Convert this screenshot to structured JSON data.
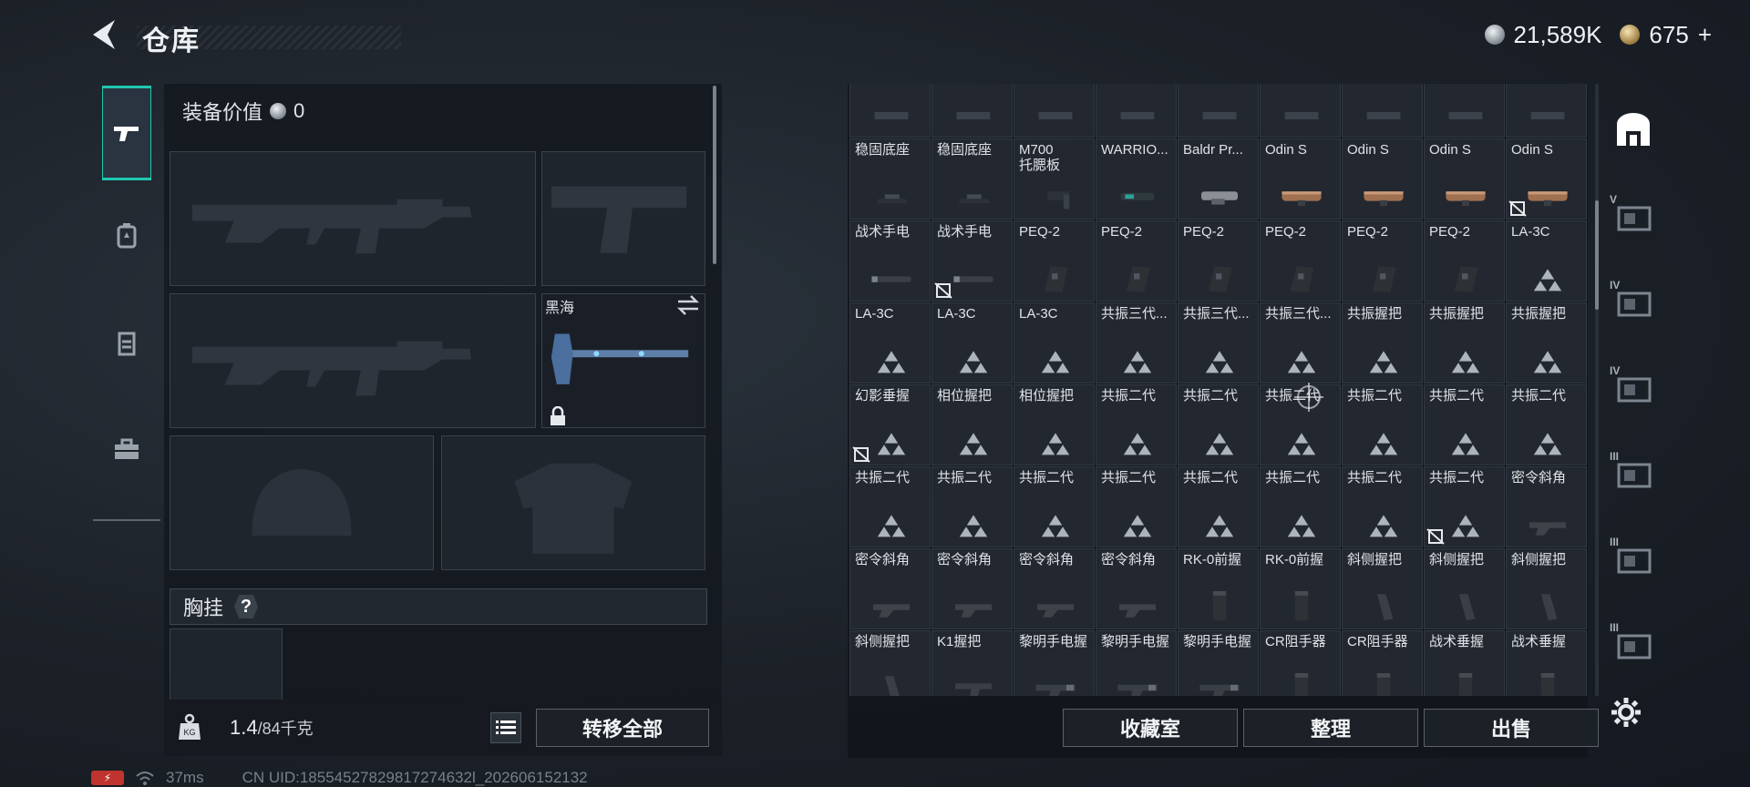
{
  "header": {
    "title": "仓库",
    "currency_silver": "21,589K",
    "currency_gold": "675",
    "plus": "+"
  },
  "loadout": {
    "equip_value_label": "装备价值",
    "equip_value": "0",
    "melee_name": "黑海",
    "vest_label": "胸挂",
    "help": "?",
    "weight_current": "1.4",
    "weight_max": "/84千克",
    "transfer_all": "转移全部"
  },
  "stash": {
    "buttons": {
      "collection": "收藏室",
      "sort": "整理",
      "sell": "出售"
    },
    "rows": [
      [
        {
          "n": "",
          "t": "rail"
        },
        {
          "n": "",
          "t": "rail"
        },
        {
          "n": "",
          "t": "rail"
        },
        {
          "n": "",
          "t": "rail"
        },
        {
          "n": "",
          "t": "rail"
        },
        {
          "n": "",
          "t": "rail"
        },
        {
          "n": "",
          "t": "rail"
        },
        {
          "n": "",
          "t": "rail"
        },
        {
          "n": "",
          "t": "rail"
        }
      ],
      [
        {
          "n": "稳固底座",
          "t": "mount"
        },
        {
          "n": "稳固底座",
          "t": "mount"
        },
        {
          "n": "M700",
          "n2": "托腮板",
          "t": "cheek"
        },
        {
          "n": "WARRIO...",
          "t": "light"
        },
        {
          "n": "Baldr Pr...",
          "t": "light2"
        },
        {
          "n": "Odin S",
          "t": "odin"
        },
        {
          "n": "Odin S",
          "t": "odin"
        },
        {
          "n": "Odin S",
          "t": "odin"
        },
        {
          "n": "Odin S",
          "t": "odin",
          "b": true
        }
      ],
      [
        {
          "n": "战术手电",
          "t": "flash"
        },
        {
          "n": "战术手电",
          "t": "flash",
          "b": true
        },
        {
          "n": "PEQ-2",
          "t": "peq"
        },
        {
          "n": "PEQ-2",
          "t": "peq"
        },
        {
          "n": "PEQ-2",
          "t": "peq"
        },
        {
          "n": "PEQ-2",
          "t": "peq"
        },
        {
          "n": "PEQ-2",
          "t": "peq"
        },
        {
          "n": "PEQ-2",
          "t": "peq"
        },
        {
          "n": "LA-3C",
          "t": "tri"
        }
      ],
      [
        {
          "n": "LA-3C",
          "t": "tri"
        },
        {
          "n": "LA-3C",
          "t": "tri"
        },
        {
          "n": "LA-3C",
          "t": "tri"
        },
        {
          "n": "共振三代...",
          "t": "tri"
        },
        {
          "n": "共振三代...",
          "t": "tri"
        },
        {
          "n": "共振三代...",
          "t": "tri"
        },
        {
          "n": "共振握把",
          "t": "tri"
        },
        {
          "n": "共振握把",
          "t": "tri"
        },
        {
          "n": "共振握把",
          "t": "tri"
        }
      ],
      [
        {
          "n": "幻影垂握",
          "t": "tri",
          "b": true
        },
        {
          "n": "相位握把",
          "t": "tri"
        },
        {
          "n": "相位握把",
          "t": "tri"
        },
        {
          "n": "共振二代",
          "t": "tri"
        },
        {
          "n": "共振二代",
          "t": "tri"
        },
        {
          "n": "共振二代",
          "t": "tri"
        },
        {
          "n": "共振二代",
          "t": "tri"
        },
        {
          "n": "共振二代",
          "t": "tri"
        },
        {
          "n": "共振二代",
          "t": "tri"
        }
      ],
      [
        {
          "n": "共振二代",
          "t": "tri"
        },
        {
          "n": "共振二代",
          "t": "tri"
        },
        {
          "n": "共振二代",
          "t": "tri"
        },
        {
          "n": "共振二代",
          "t": "tri"
        },
        {
          "n": "共振二代",
          "t": "tri"
        },
        {
          "n": "共振二代",
          "t": "tri"
        },
        {
          "n": "共振二代",
          "t": "tri"
        },
        {
          "n": "共振二代",
          "t": "tri",
          "b": true
        },
        {
          "n": "密令斜角",
          "t": "angle"
        }
      ],
      [
        {
          "n": "密令斜角",
          "t": "angle"
        },
        {
          "n": "密令斜角",
          "t": "angle"
        },
        {
          "n": "密令斜角",
          "t": "angle"
        },
        {
          "n": "密令斜角",
          "t": "angle"
        },
        {
          "n": "RK-0前握",
          "t": "vgrip"
        },
        {
          "n": "RK-0前握",
          "t": "vgrip"
        },
        {
          "n": "斜侧握把",
          "t": "sgrip"
        },
        {
          "n": "斜侧握把",
          "t": "sgrip"
        },
        {
          "n": "斜侧握把",
          "t": "sgrip"
        }
      ],
      [
        {
          "n": "斜侧握把",
          "t": "sgrip"
        },
        {
          "n": "K1握把",
          "t": "k1"
        },
        {
          "n": "黎明手电握",
          "t": "dawn"
        },
        {
          "n": "黎明手电握",
          "t": "dawn"
        },
        {
          "n": "黎明手电握",
          "t": "dawn"
        },
        {
          "n": "CR阻手器",
          "t": "vgrip"
        },
        {
          "n": "CR阻手器",
          "t": "vgrip"
        },
        {
          "n": "战术垂握",
          "t": "vgrip"
        },
        {
          "n": "战术垂握",
          "t": "vgrip"
        }
      ]
    ]
  },
  "status": {
    "ping": "37ms",
    "uid": "CN UID:18554527829817274632l_202606152132"
  },
  "filters": [
    "全部",
    "V",
    "IV",
    "IV",
    "III",
    "III",
    "III"
  ],
  "colors": {
    "accent": "#1fc8b0",
    "bg": "#1b2027"
  }
}
